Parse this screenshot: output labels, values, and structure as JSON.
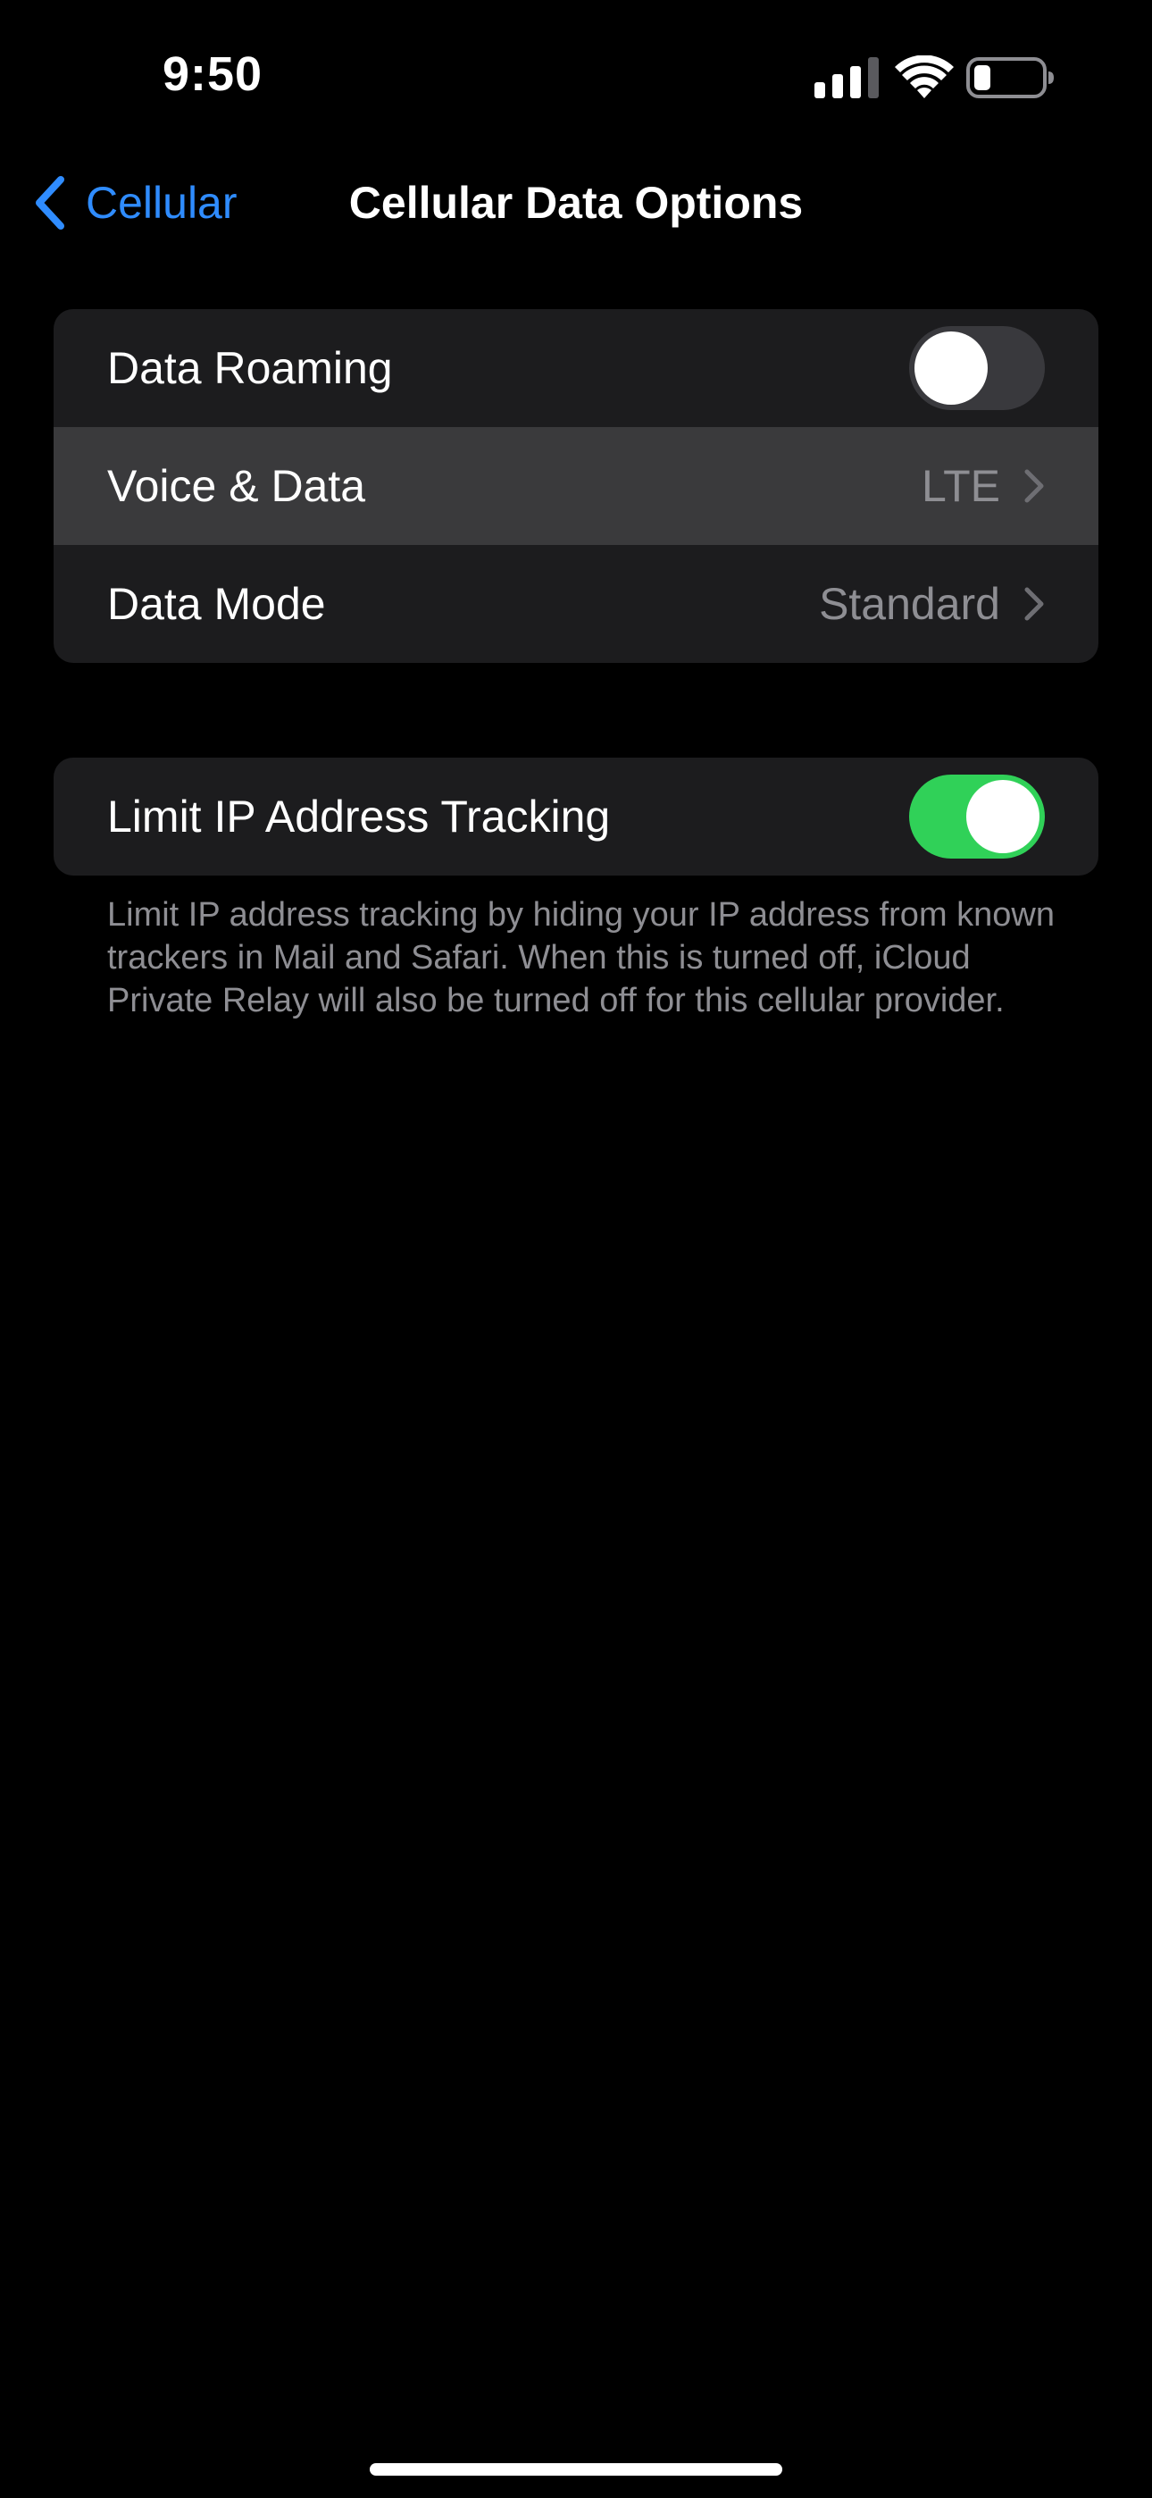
{
  "status_bar": {
    "time": "9:50",
    "icons": [
      "signal-icon",
      "wifi-icon",
      "battery-icon"
    ]
  },
  "nav": {
    "back_label": "Cellular",
    "back_icon": "chevron-left-icon",
    "title": "Cellular Data Options"
  },
  "group1": {
    "rows": [
      {
        "label": "Data Roaming",
        "control": "toggle",
        "state": "off"
      },
      {
        "label": "Voice & Data",
        "value": "LTE",
        "control": "chevron-right-icon"
      },
      {
        "label": "Data Mode",
        "value": "Standard",
        "control": "chevron-right-icon"
      }
    ]
  },
  "group2": {
    "rows": [
      {
        "label": "Limit IP Address Tracking",
        "control": "toggle",
        "state": "on"
      }
    ],
    "footer": "Limit IP address tracking by hiding your IP address from known trackers in Mail and Safari. When this is turned off, iCloud Private Relay will also be turned off for this cellular provider."
  },
  "colors": {
    "background": "#000000",
    "group_background": "#1c1c1e",
    "highlight": "#3a3a3c",
    "accent": "#2f8cff",
    "toggle_on": "#30d158",
    "toggle_off": "#39393d",
    "secondary_text": "#8e8e93"
  }
}
